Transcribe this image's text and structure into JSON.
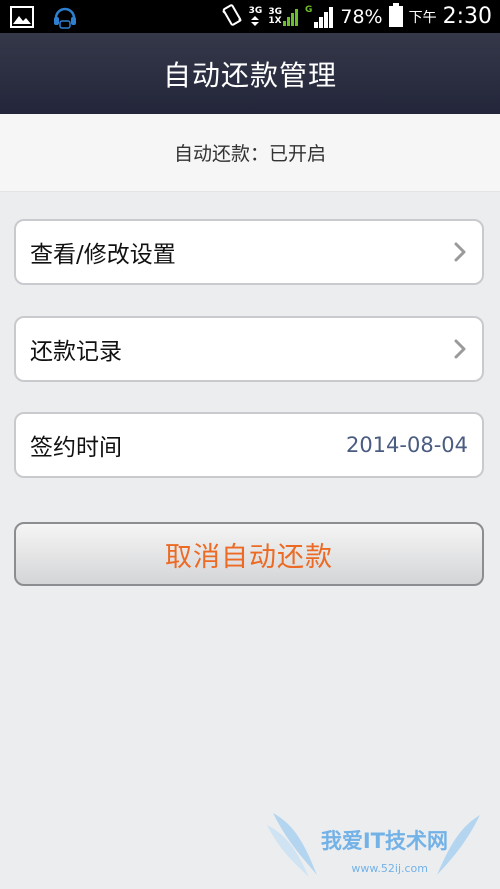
{
  "status_bar": {
    "network_1": "3G",
    "network_2_top": "3G",
    "network_2_bottom": "1X",
    "network_3": "G",
    "battery": "78%",
    "ampm": "下午",
    "time": "2:30",
    "icons": [
      "gallery-icon",
      "headset-icon",
      "vibrate-icon",
      "signal-icon",
      "battery-icon"
    ]
  },
  "header": {
    "title": "自动还款管理"
  },
  "status_strip": {
    "text": "自动还款：已开启"
  },
  "menu": {
    "settings_label": "查看/修改设置",
    "records_label": "还款记录",
    "sign_date_label": "签约时间",
    "sign_date_value": "2014-08-04"
  },
  "actions": {
    "cancel_label": "取消自动还款"
  },
  "watermark": {
    "text": "我爱IT技术网",
    "site": "www.52ij.com"
  },
  "colors": {
    "accent": "#ec6a24",
    "value_text": "#4a5c80",
    "header_bg": "#2a2d40",
    "page_bg": "#ecedef"
  }
}
